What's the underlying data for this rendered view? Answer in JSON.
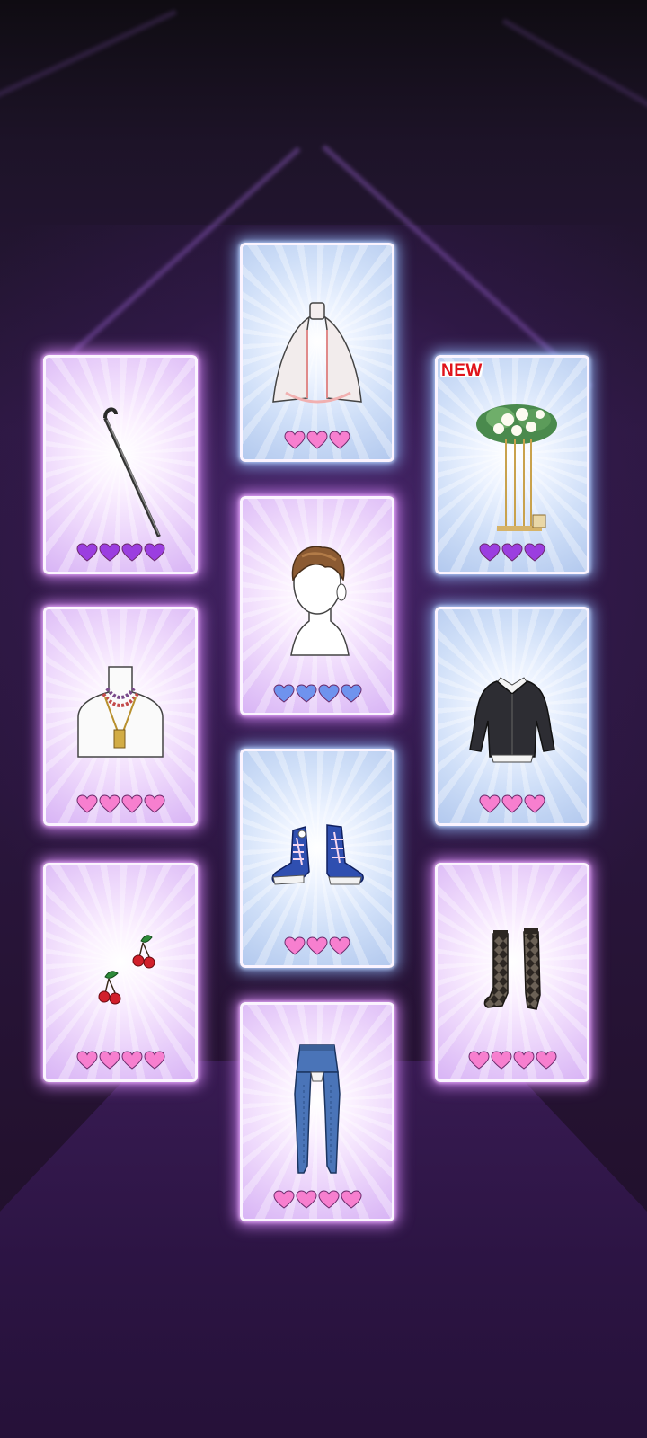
{
  "colors": {
    "heart_pink": "#f77fcf",
    "heart_purple": "#9b3ee0",
    "heart_blue": "#6f93ee",
    "new_badge": "#e0131b"
  },
  "cards": [
    {
      "name": "cane-card",
      "item_icon": "cane-icon",
      "style": "pink",
      "hearts": 4,
      "heart_color": "purple"
    },
    {
      "name": "cape-card",
      "item_icon": "cape-icon",
      "style": "blue",
      "hearts": 3,
      "heart_color": "pink"
    },
    {
      "name": "flower-stand-card",
      "item_icon": "flower-stand-icon",
      "style": "blue",
      "hearts": 3,
      "heart_color": "purple",
      "badge": "NEW"
    },
    {
      "name": "hairstyle-card",
      "item_icon": "hairstyle-icon",
      "style": "pink",
      "hearts": 4,
      "heart_color": "blue"
    },
    {
      "name": "necklace-card",
      "item_icon": "necklace-icon",
      "style": "pink",
      "hearts": 4,
      "heart_color": "pink"
    },
    {
      "name": "blazer-card",
      "item_icon": "blazer-icon",
      "style": "blue",
      "hearts": 3,
      "heart_color": "pink"
    },
    {
      "name": "sneakers-card",
      "item_icon": "sneakers-icon",
      "style": "blue",
      "hearts": 3,
      "heart_color": "pink"
    },
    {
      "name": "cherry-earrings-card",
      "item_icon": "cherry-earrings-icon",
      "style": "pink",
      "hearts": 4,
      "heart_color": "pink"
    },
    {
      "name": "argyle-socks-card",
      "item_icon": "argyle-socks-icon",
      "style": "pink",
      "hearts": 4,
      "heart_color": "pink"
    },
    {
      "name": "denim-pants-card",
      "item_icon": "denim-pants-icon",
      "style": "pink",
      "hearts": 4,
      "heart_color": "pink"
    }
  ]
}
